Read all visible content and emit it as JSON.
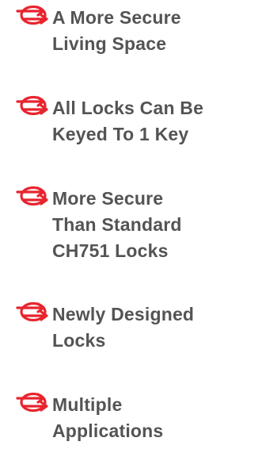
{
  "features": [
    {
      "lines": [
        "A More Secure",
        "Living Space"
      ]
    },
    {
      "lines": [
        "All Locks Can Be",
        "Keyed To 1 Key"
      ]
    },
    {
      "lines": [
        "More Secure",
        "Than Standard",
        "CH751 Locks"
      ]
    },
    {
      "lines": [
        "Newly Designed",
        "Locks"
      ]
    },
    {
      "lines": [
        "Multiple",
        "Applications"
      ]
    }
  ],
  "icon": {
    "name": "circled-double-arrow-icon",
    "color": "#e8242e"
  },
  "text_color": "#545454"
}
